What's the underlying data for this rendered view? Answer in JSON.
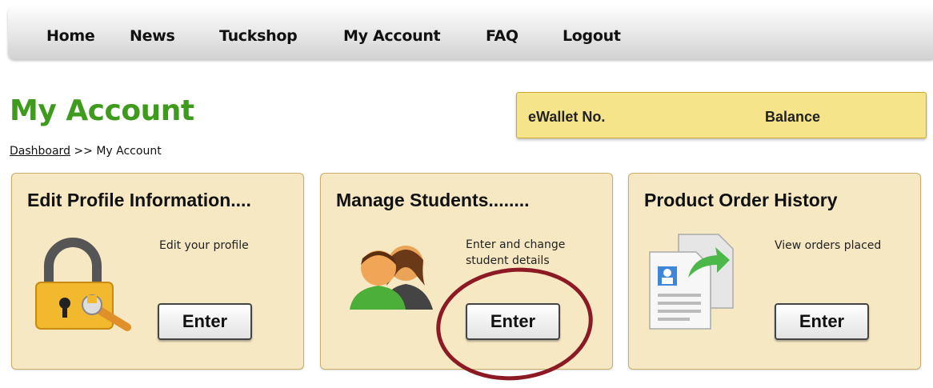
{
  "nav": {
    "items": [
      {
        "label": "Home"
      },
      {
        "label": "News"
      },
      {
        "label": "Tuckshop"
      },
      {
        "label": "My Account"
      },
      {
        "label": "FAQ"
      },
      {
        "label": "Logout"
      }
    ]
  },
  "page": {
    "title": "My Account",
    "breadcrumb_link": "Dashboard",
    "breadcrumb_sep": ">>",
    "breadcrumb_current": "My Account"
  },
  "wallet": {
    "number_label": "eWallet No.",
    "balance_label": "Balance"
  },
  "cards": [
    {
      "title": "Edit Profile Information....",
      "description": "Edit your profile",
      "button": "Enter",
      "icon": "padlock-wrench-icon"
    },
    {
      "title": "Manage Students........",
      "description_line1": "Enter and change",
      "description_line2": "student details",
      "button": "Enter",
      "icon": "two-people-icon"
    },
    {
      "title": "Product Order History",
      "description": "View orders placed",
      "button": "Enter",
      "icon": "document-arrow-icon"
    }
  ],
  "colors": {
    "title_green": "#3f9b1e",
    "wallet_bg": "#f6e48a",
    "card_bg": "#f7e8c4",
    "annotation": "#8b1a24"
  }
}
